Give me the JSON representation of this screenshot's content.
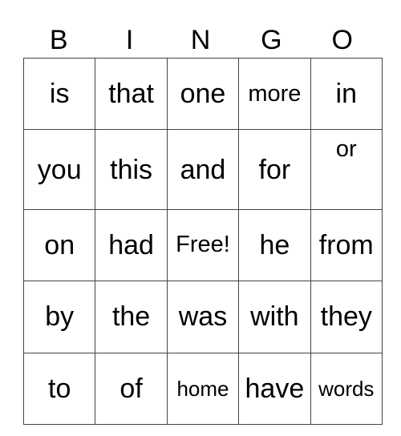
{
  "header": {
    "letters": [
      "B",
      "I",
      "N",
      "G",
      "O"
    ]
  },
  "card": {
    "rows": [
      [
        "is",
        "that",
        "one",
        "more",
        "in"
      ],
      [
        "you",
        "this",
        "and",
        "for",
        "or"
      ],
      [
        "on",
        "had",
        "Free!",
        "he",
        "from"
      ],
      [
        "by",
        "the",
        "was",
        "with",
        "they"
      ],
      [
        "to",
        "of",
        "home",
        "have",
        "words"
      ]
    ],
    "free_space": "Free!"
  }
}
